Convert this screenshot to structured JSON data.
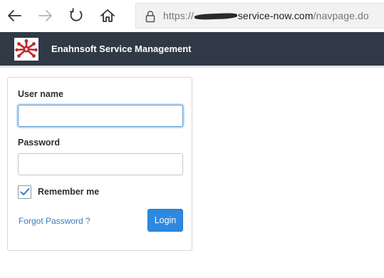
{
  "browser": {
    "back_icon": "arrow-left-icon",
    "forward_icon": "arrow-right-icon",
    "refresh_icon": "refresh-icon",
    "home_icon": "home-icon",
    "lock_icon": "lock-icon",
    "url_prefix": "https://",
    "url_host": "service-now.com",
    "url_path": "/navpage.do"
  },
  "header": {
    "title": "Enahnsoft Service Management",
    "background": "#303a46",
    "logo_icon": "logo-icon"
  },
  "login": {
    "username_label": "User name",
    "username_value": "",
    "password_label": "Password",
    "password_value": "",
    "remember_label": "Remember me",
    "remember_checked": true,
    "forgot_label": "Forgot Password ?",
    "login_label": "Login",
    "accent": "#2d88e0"
  }
}
